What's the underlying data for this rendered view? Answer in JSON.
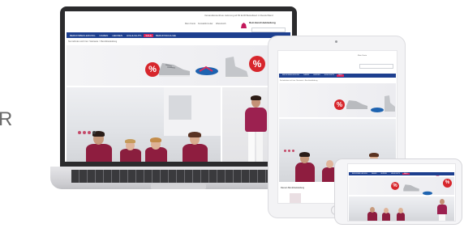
{
  "side_letter": "R",
  "site": {
    "header_text": "Versandkostenfreie Lieferung ab 50 EUR Bestellwert in Deutschland",
    "header_links": [
      "Mein Konto",
      "Kontaktformular",
      "Warenkorb"
    ],
    "brand_name": "Rein Berufsbekleidung",
    "nav_items": [
      "BERUFSBEKLEIDUNG",
      "DAMEN",
      "HERREN",
      "HIGHLIGHTS",
      "SALE",
      "BERUFSSCHUHE"
    ],
    "breadcrumb": "Sie befinden sich hier: Startseite > Berufsbekleidung",
    "sale_badge": "%",
    "section_heading": "Damen Berufsbekleidung"
  },
  "colors": {
    "nav": "#1d3f8f",
    "nav_active": "#d8235a",
    "badge": "#d7262c",
    "scrubs": "#8e1d3f",
    "laptop_frame": "#2b2b2d",
    "laptop_base": "#d9d9dc",
    "tablet_frame": "#f3f3f5"
  },
  "icons": [
    "brand-logo-icon",
    "slider-dots-icon",
    "camera-icon",
    "home-button-icon"
  ]
}
